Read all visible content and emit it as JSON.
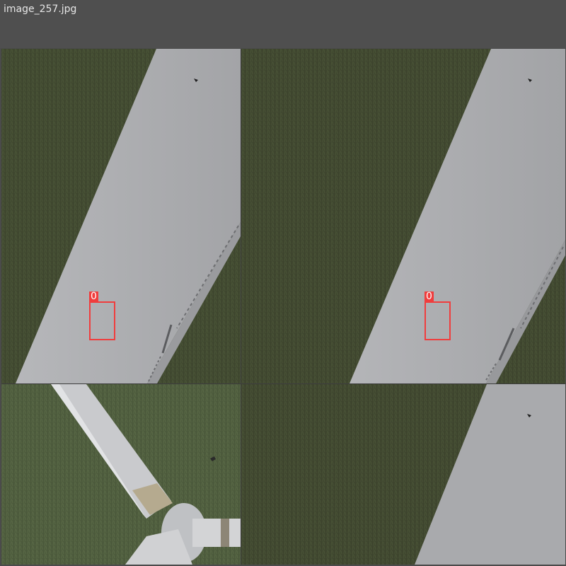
{
  "window": {
    "title": "image_257.jpg"
  },
  "images": [
    {
      "annotations": [
        {
          "label": "0"
        }
      ]
    },
    {
      "annotations": [
        {
          "label": "0"
        }
      ]
    },
    {
      "annotations": []
    },
    {
      "annotations": []
    }
  ],
  "colors": {
    "grass": "#3f472f",
    "blade": "#a7a8ab",
    "box": "#f03d3d"
  }
}
